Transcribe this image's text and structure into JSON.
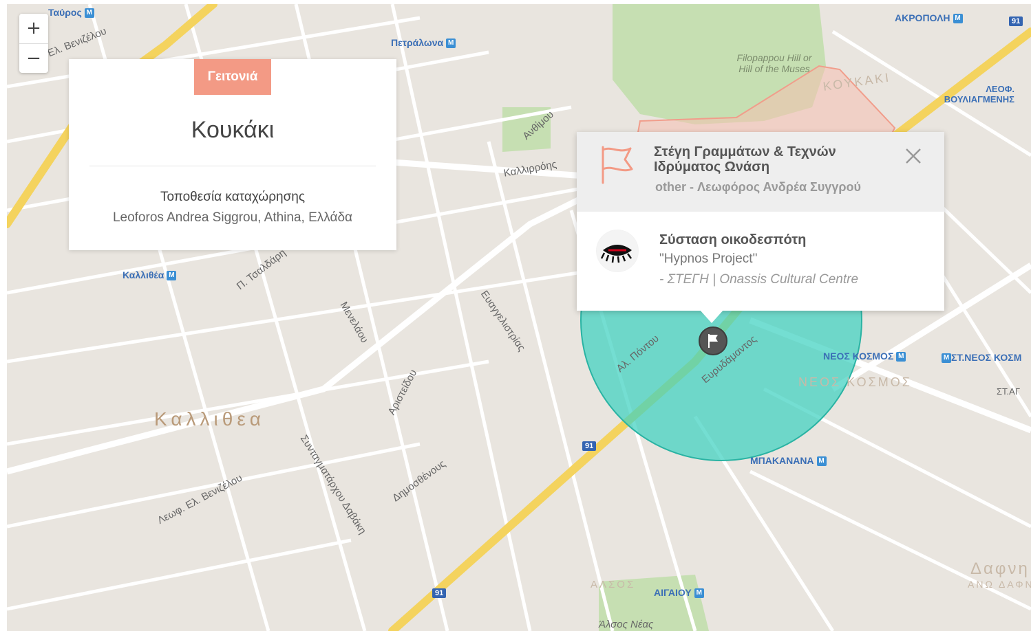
{
  "map": {
    "zoom_in_label": "+",
    "zoom_out_label": "−",
    "colors": {
      "land": "#e9e5df",
      "road": "#ffffff",
      "highway": "#f4d35e",
      "park": "#c6dfb2",
      "neighborhood_fill": "#f6c0b1",
      "radius_fill": "#3fd1c1",
      "metro": "#3b8fd4"
    },
    "labels": {
      "area_kallithea": "Καλλιθεα",
      "area_neos_kosmos": "ΝΕΟΣ ΚΟΣΜΟΣ",
      "area_koukaki": "ΚΟΥΚΑΚΙ",
      "area_dafni": "Δαφνη",
      "park_filopappou": "Filopappou Hill or Hill of the Muses",
      "alsos": "ΑΛΣΟΣ",
      "alsos_neas": "Άλσος Νέας",
      "st_tavros": "Ταύρος",
      "st_petralona": "Πετράλωνα",
      "st_akropoli": "ΑΚΡΟΠΟΛΗ",
      "st_kallithea": "Καλλιθέα",
      "st_neos_kosmos": "ΝΕΟΣ ΚΟΣΜΟΣ",
      "st_st_neos_kosmos": "ΣΤ.ΝΕΟΣ ΚΟΣΜ",
      "st_mpakanana": "ΜΠΑΚΑΝΑΝΑ",
      "st_aigaiou": "ΑΙΓΑΙΟΥ",
      "st_leof_vouliagmenis": "ΛΕΟΦ. ΒΟΥΛΙΑΓΜΕΝΗΣ",
      "st_ano_dafni": "ΑΝΩ ΔΑΦΝΗ",
      "st_af": "ΣΤ.ΑΓ",
      "street_venizelou_top": "Ελ. Βενιζέλου",
      "street_kallirrois": "Καλλιρρόης",
      "street_syngrou": "Λεωφ. Ελ. Βενιζέλου",
      "street_tsaldari": "Π. Τσαλδάρη",
      "street_evangelistrias": "Ευαγγελιστρίας",
      "street_al_pontou": "Αλ. Πόντου",
      "street_evrydamantos": "Ευρυδάμαντος",
      "street_menelaou": "Μενελάου",
      "street_anthimou": "Ανθίμου",
      "street_syntagmatarchou": "Συνταγματάρχου Δαβάκη",
      "street_dimosthenous": "Δημοσθένους",
      "street_aristeidou": "Αριστείδου",
      "route_91": "91"
    }
  },
  "neighborhood": {
    "badge": "Γειτονιά",
    "name": "Κουκάκι",
    "location_label": "Τοποθεσία καταχώρησης",
    "location_value": "Leoforos Andrea Siggrou, Athina, Ελλάδα"
  },
  "popup": {
    "title": "Στέγη Γραμμάτων & Τεχνών Ιδρύματος Ωνάση",
    "subtitle": "other - Λεωφόρος Ανδρέα Συγγρού",
    "event_title": "Σύσταση οικοδεσπότη",
    "event_quote": "\"Hypnos Project\"",
    "event_venue": "- ΣΤΕΓΗ | Onassis Cultural Centre"
  }
}
